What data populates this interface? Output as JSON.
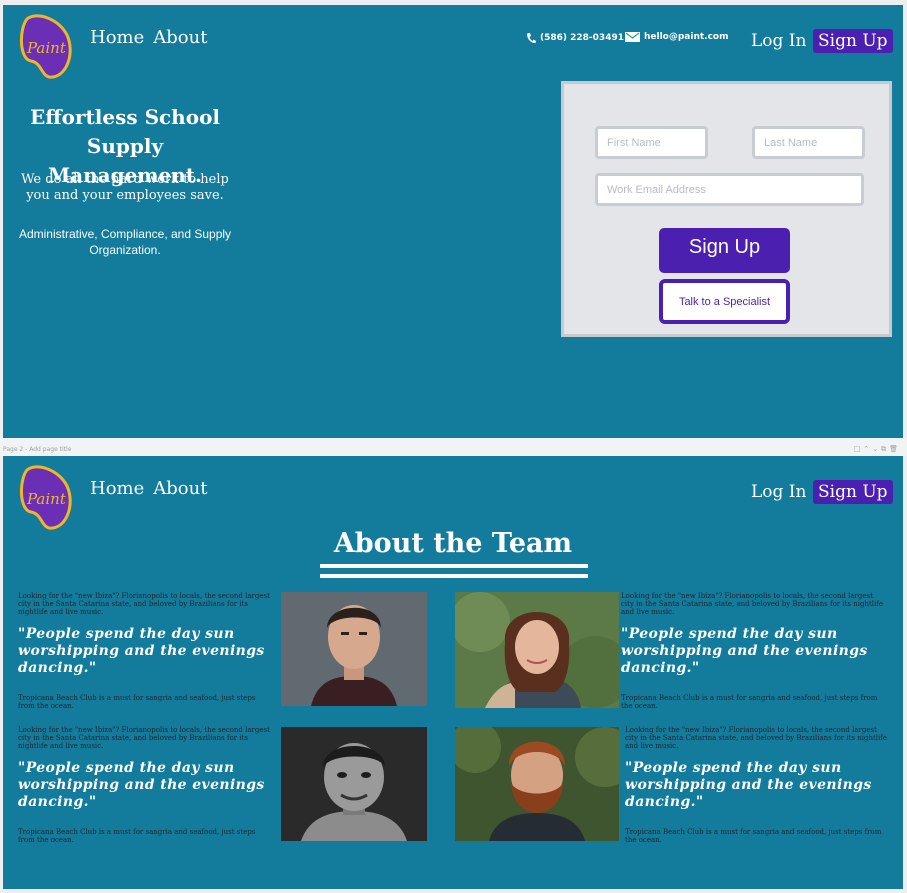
{
  "brand": {
    "logo_text": "Paint"
  },
  "nav": {
    "home": "Home",
    "about": "About"
  },
  "contact": {
    "phone": "(586) 228-03491",
    "email": "hello@paint.com"
  },
  "auth": {
    "login": "Log In",
    "signup": "Sign Up"
  },
  "hero": {
    "title": "Effortless School Supply Management.",
    "subtitle": "We do all the hard work to help you and your employees save.",
    "tagline": "Administrative, Compliance, and Supply Organization."
  },
  "form": {
    "first_name_placeholder": "First Name",
    "last_name_placeholder": "Last Name",
    "email_placeholder": "Work Email Address",
    "signup_button": "Sign Up",
    "specialist_button": "Talk to a Specialist"
  },
  "separator": {
    "page_label": "Page 2 -",
    "add_title": "Add page title"
  },
  "team": {
    "title": "About the Team",
    "members": [
      {
        "intro": "Looking for the \"new Ibiza\"? Florianopolis to locals, the second largest city in the Santa Catarina state, and beloved by Brazilians for its nightlife and live music.",
        "quote": "\"People spend the day sun worshipping and the evenings dancing.\"",
        "footer": "Tropicana Beach Club is a must for sangria and seafood, just steps from the ocean."
      },
      {
        "intro": "Looking for the \"new Ibiza\"? Florianopolis to locals, the second largest city in the Santa Catarina state, and beloved by Brazilians for its nightlife and live music.",
        "quote": "\"People spend the day sun worshipping and the evenings dancing.\"",
        "footer": "Tropicana Beach Club is a must for sangria and seafood, just steps from the ocean."
      },
      {
        "intro": "Looking for the \"new Ibiza\"? Florianopolis to locals, the second largest city in the Santa Catarina state, and beloved by Brazilians for its nightlife and live music.",
        "quote": "\"People spend the day sun worshipping and the evenings dancing.\"",
        "footer": "Tropicana Beach Club is a must for sangria and seafood, just steps from the ocean."
      },
      {
        "intro": "Looking for the \"new Ibiza\"? Florianopolis to locals, the second largest city in the Santa Catarina state, and beloved by Brazilians for its nightlife and live music.",
        "quote": "\"People spend the day sun worshipping and the evenings dancing.\"",
        "footer": "Tropicana Beach Club is a must for sangria and seafood, just steps from the ocean."
      }
    ]
  },
  "colors": {
    "page_bg": "#137b9b",
    "accent": "#4b1fb0",
    "logo_fill": "#6a2fb5",
    "logo_border": "#f0b52a"
  },
  "icons": {
    "phone": "phone-icon",
    "email": "envelope-icon"
  }
}
